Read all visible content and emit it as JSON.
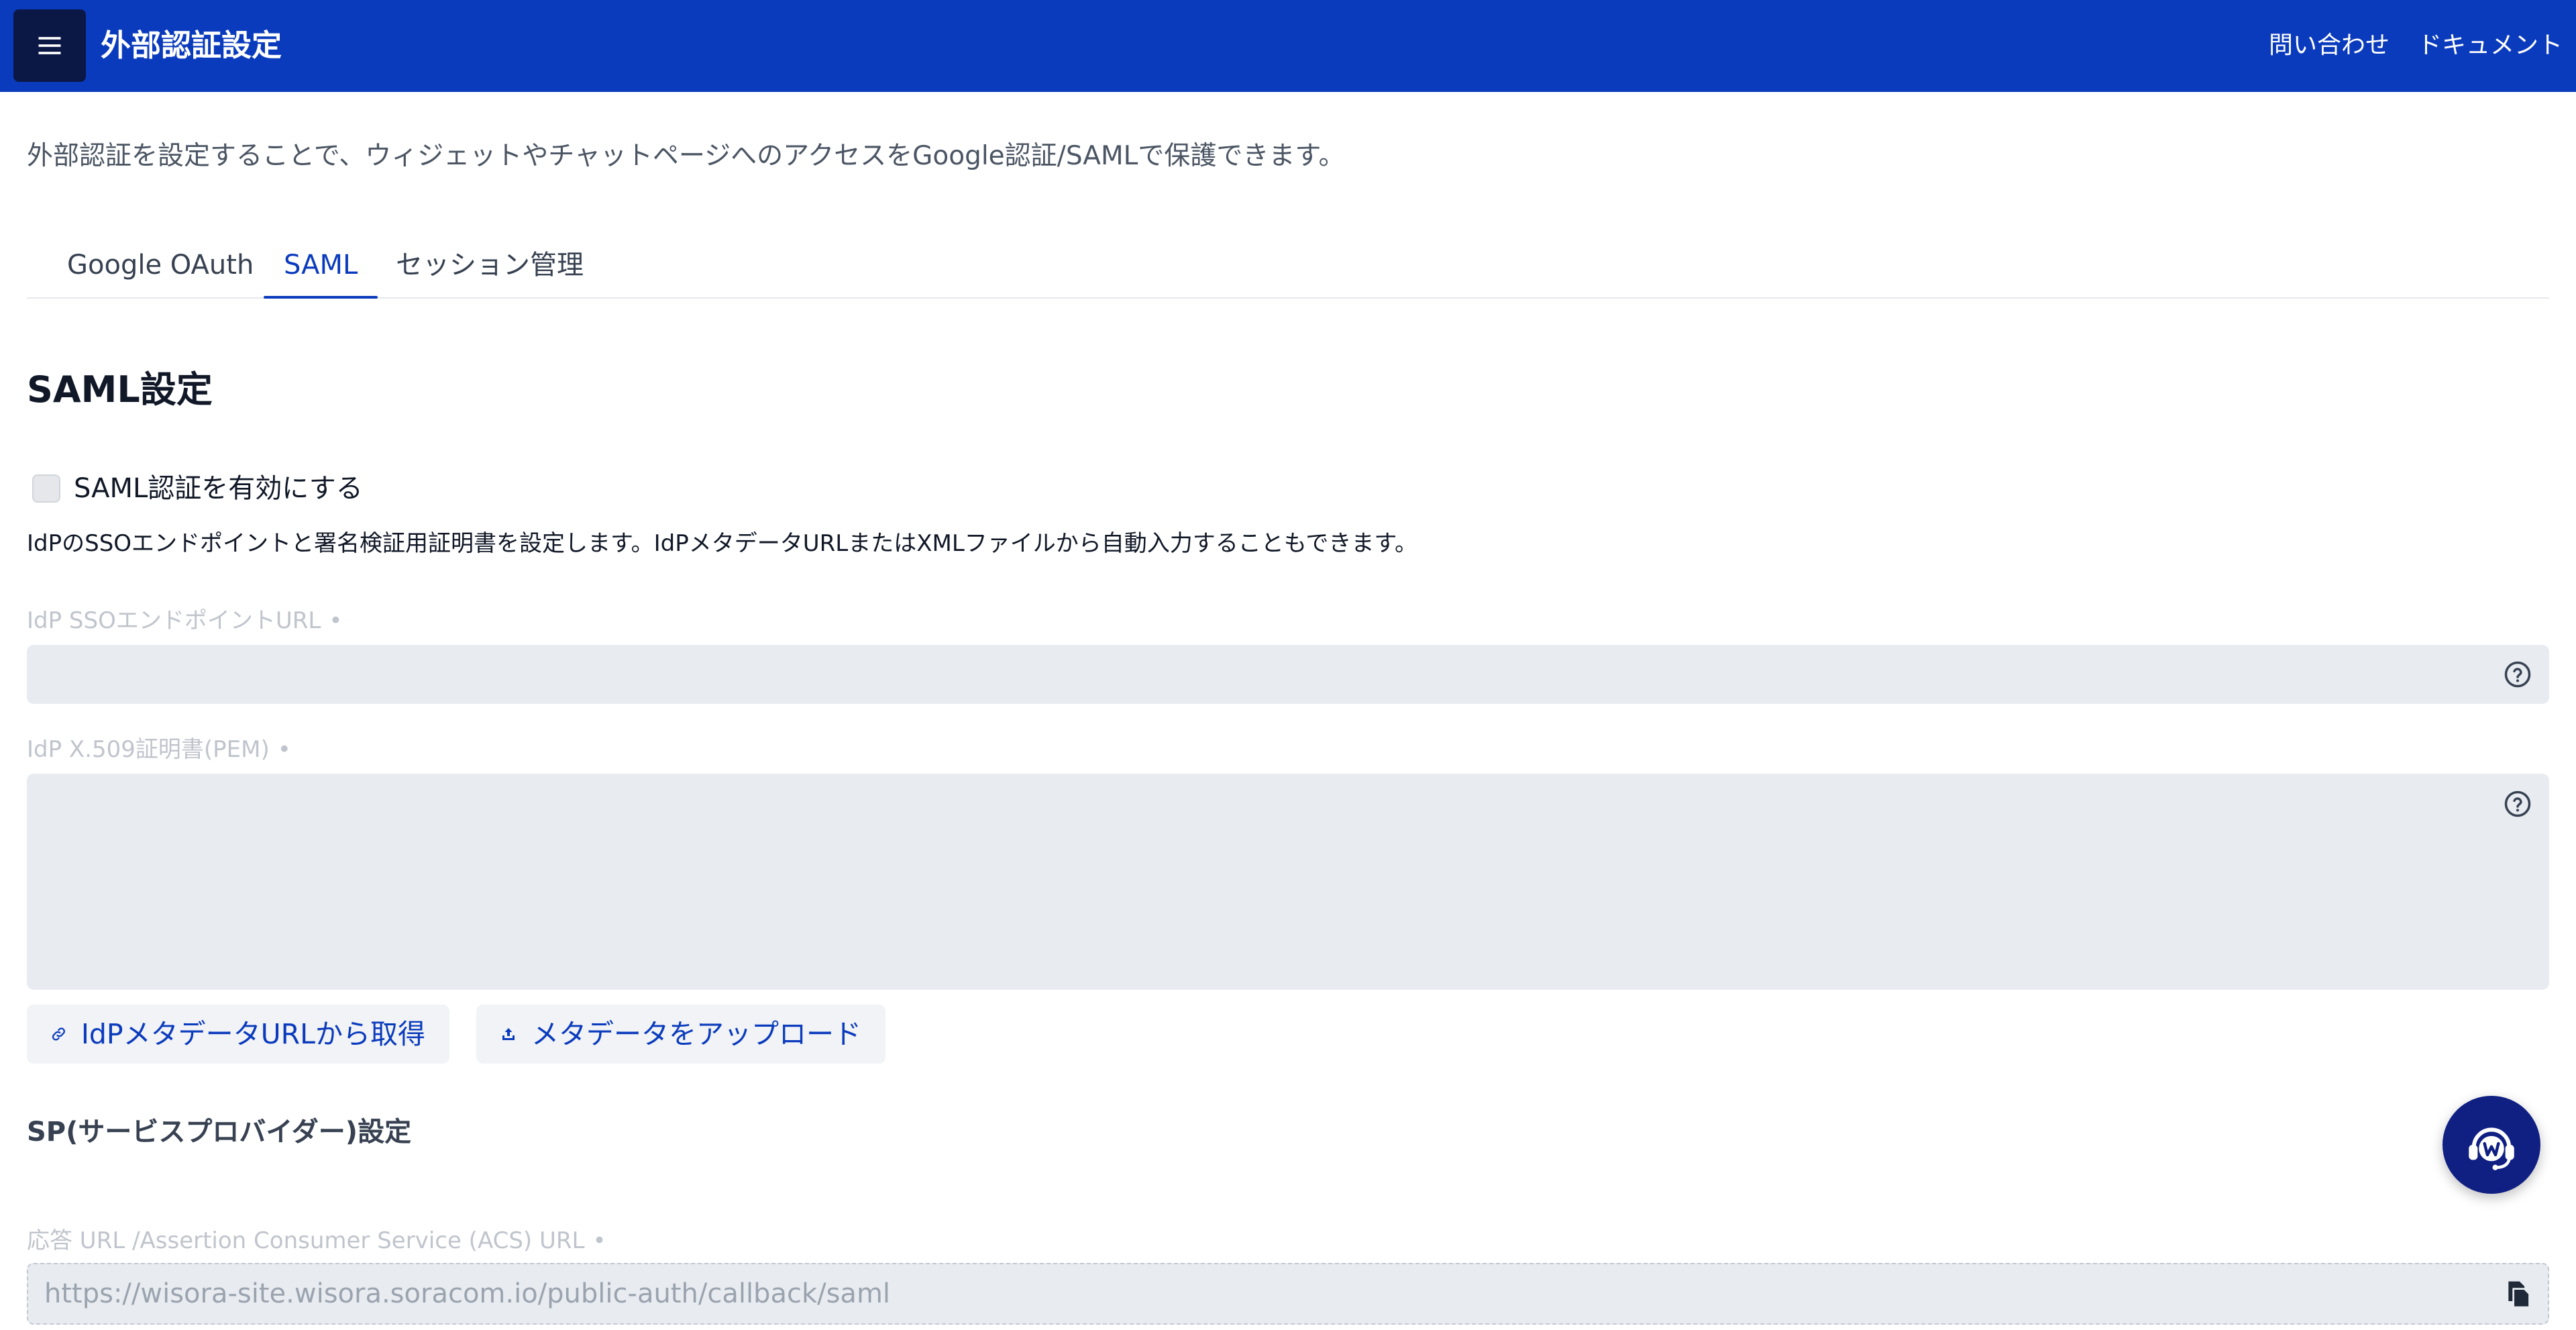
{
  "header": {
    "title": "外部認証設定",
    "links": [
      "問い合わせ",
      "ドキュメント"
    ],
    "bg_color": "#0b3bbd"
  },
  "description": "外部認証を設定することで、ウィジェットやチャットページへのアクセスをGoogle認証/SAMLで保護できます。",
  "tabs": [
    {
      "label": "Google OAuth",
      "active": false
    },
    {
      "label": "SAML",
      "active": true
    },
    {
      "label": "セッション管理",
      "active": false
    }
  ],
  "saml": {
    "title": "SAML設定",
    "enable_label": "SAML認証を有効にする",
    "enabled": false,
    "help_text": "IdPのSSOエンドポイントと署名検証用証明書を設定します。IdPメタデータURLまたはXMLファイルから自動入力することもできます。",
    "sso_url_label": "IdP SSOエンドポイントURL",
    "sso_url_value": "",
    "cert_label": "IdP X.509証明書(PEM)",
    "cert_value": "",
    "required_marker": "•",
    "fetch_button": "IdPメタデータURLから取得",
    "upload_button": "メタデータをアップロード"
  },
  "sp": {
    "title": "SP(サービスプロバイダー)設定",
    "acs_label": "応答 URL /Assertion Consumer Service (ACS) URL",
    "acs_value": "https://wisora-site.wisora.soracom.io/public-auth/callback/saml"
  },
  "icons": {
    "menu": "hamburger-icon",
    "help": "question-circle-icon",
    "link": "link-icon",
    "upload": "upload-icon",
    "copy": "copy-icon",
    "chat": "support-chat-icon"
  },
  "colors": {
    "accent": "#0b3bbd",
    "fab": "#0f1f82"
  }
}
